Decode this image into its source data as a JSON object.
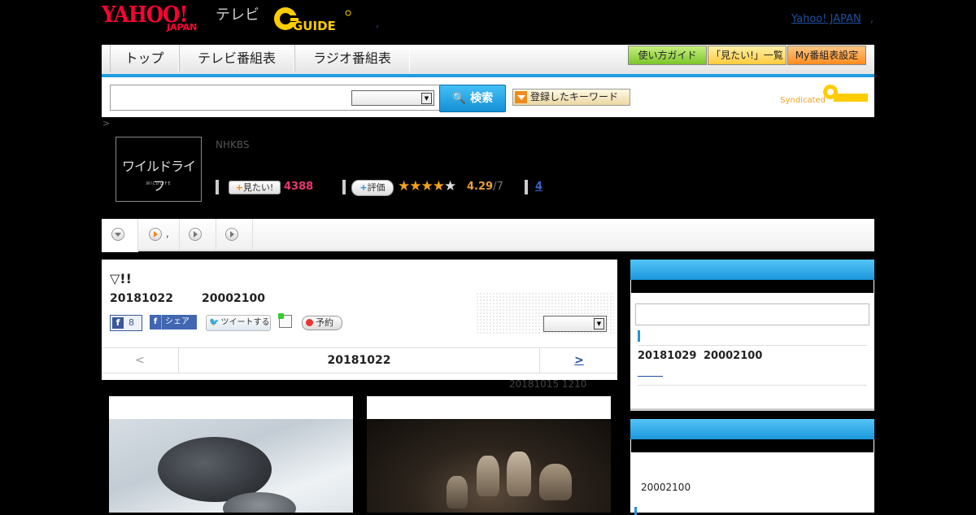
{
  "header": {
    "yahoo_logo": "YAHOO!",
    "yahoo_logo_sub": "JAPAN",
    "tv_label": "テレビ",
    "gguide_logo": "GUIDE",
    "comma_left": ",",
    "yahoo_japan_link": "Yahoo! JAPAN",
    "comma_right": ","
  },
  "nav": {
    "tabs": [
      {
        "label": "トップ"
      },
      {
        "label": "テレビ番組表"
      },
      {
        "label": "ラジオ番組表"
      }
    ],
    "buttons": [
      {
        "label": "使い方ガイド",
        "color": "#8fd43a"
      },
      {
        "label": "「見たい!」一覧",
        "color": "#ffd34d"
      },
      {
        "label": "My番組表設定",
        "color": "#ff9a2e"
      }
    ]
  },
  "search": {
    "input_value": "",
    "select_value": "",
    "button_label": "検索",
    "keyword_button_label": "登録したキーワード",
    "syndicated_label": "Syndicated"
  },
  "breadcrumb": ">",
  "program": {
    "thumbnail_title": "ワイルドライフ",
    "thumbnail_subtitle": "WILDLIFE",
    "channel": "NHKBS",
    "mitai_label": "見たい!",
    "mitai_count": "4388",
    "hyoka_label": "評価",
    "rating": 4.29,
    "rating_text": "4.29",
    "rating_denominator": "/7",
    "review_count": "4"
  },
  "subtabs": [
    {
      "label": ""
    },
    {
      "label": ","
    },
    {
      "label": ""
    },
    {
      "label": ""
    }
  ],
  "episode": {
    "title": "▽!!",
    "date": "20181022",
    "time": "20002100",
    "fb_like_count": "8",
    "fb_share_label": "シェア",
    "tweet_label": "ツイートする",
    "reserve_label": "予約",
    "pager_prev": "<",
    "pager_date": "20181022",
    "pager_next": ">",
    "updated": "20181015  1210"
  },
  "sidebar": {
    "box1": {
      "next_date": "20181029",
      "next_time": "20002100"
    },
    "box2": {
      "time": "20002100"
    }
  },
  "colors": {
    "accent_blue": "#1e9be0",
    "link_blue": "#1e50a2",
    "yahoo_red": "#ff0033",
    "gguide_yellow": "#ffcc00",
    "mitai_pink": "#e8386e",
    "star_orange": "#f2a21b"
  }
}
